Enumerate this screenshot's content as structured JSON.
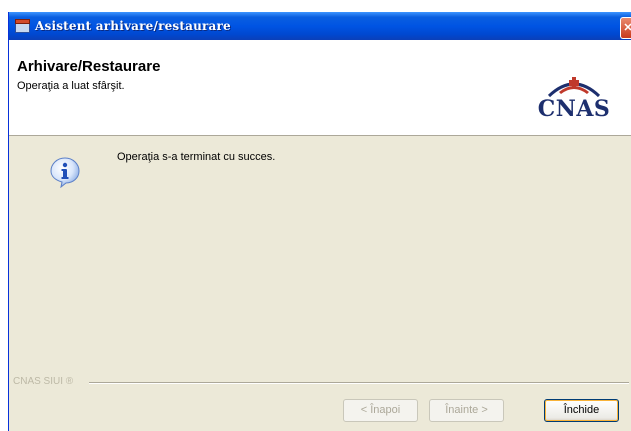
{
  "window": {
    "title": "Asistent arhivare/restaurare"
  },
  "header": {
    "title": "Arhivare/Restaurare",
    "subtitle": "Operaţia a luat sfârşit.",
    "logo_text": "CNAS"
  },
  "content": {
    "message": "Operaţia s-a terminat cu succes."
  },
  "footer": {
    "brand_label": "CNAS SIUI ®"
  },
  "buttons": {
    "back": "< Înapoi",
    "next": "Înainte >",
    "close": "Închide"
  },
  "colors": {
    "titlebar": "#0054e3",
    "dialog_bg": "#ece9d8",
    "logo": "#1d2f6e",
    "logo_accent": "#c0392b"
  }
}
